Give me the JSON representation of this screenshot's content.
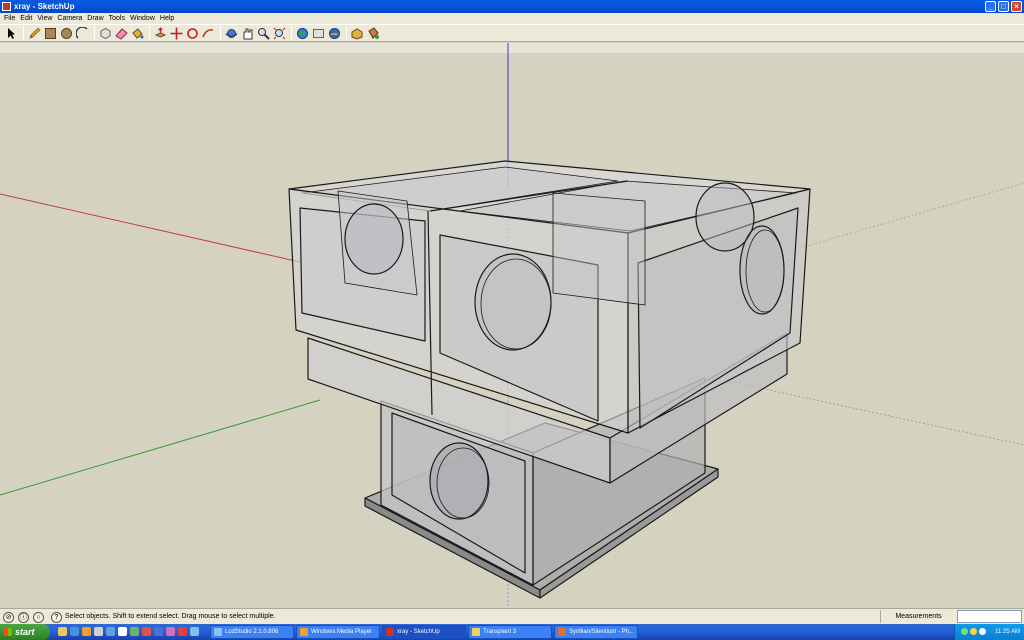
{
  "window": {
    "title": "xray - SketchUp"
  },
  "menu": [
    "File",
    "Edit",
    "View",
    "Camera",
    "Draw",
    "Tools",
    "Window",
    "Help"
  ],
  "toolbar": {
    "tools": [
      "select-arrow-icon",
      "pencil-icon",
      "rectangle-icon",
      "circle-icon",
      "arc-icon",
      "make-component-icon",
      "eraser-icon",
      "paint-bucket-icon",
      "push-pull-icon",
      "move-icon",
      "rotate-icon",
      "follow-me-icon",
      "orbit-icon",
      "pan-icon",
      "zoom-icon",
      "zoom-extents-icon",
      "get-models-icon",
      "share-model-icon",
      "google-earth-icon",
      "components-icon",
      "materials-icon"
    ]
  },
  "status": {
    "hint": "Select objects. Shift to extend select. Drag mouse to select multiple.",
    "measurements_label": "Measurements",
    "measurements_value": ""
  },
  "taskbar": {
    "start_label": "start",
    "tasks": [
      {
        "label": "LcdStudio 2.1.0.806",
        "active": false
      },
      {
        "label": "Windows Media Player",
        "active": false
      },
      {
        "label": "xray - SketchUp",
        "active": true
      },
      {
        "label": "Transplant 3",
        "active": false
      },
      {
        "label": "Syrillian/Silentium - Ph...",
        "active": false
      }
    ],
    "clock": "11:25 AM"
  },
  "colors": {
    "titlebar": "#0454e2",
    "viewport_ground": "#d5d3c0",
    "axis_red": "#c04040",
    "axis_green": "#3a9a3a",
    "axis_blue": "#3a3acc"
  }
}
